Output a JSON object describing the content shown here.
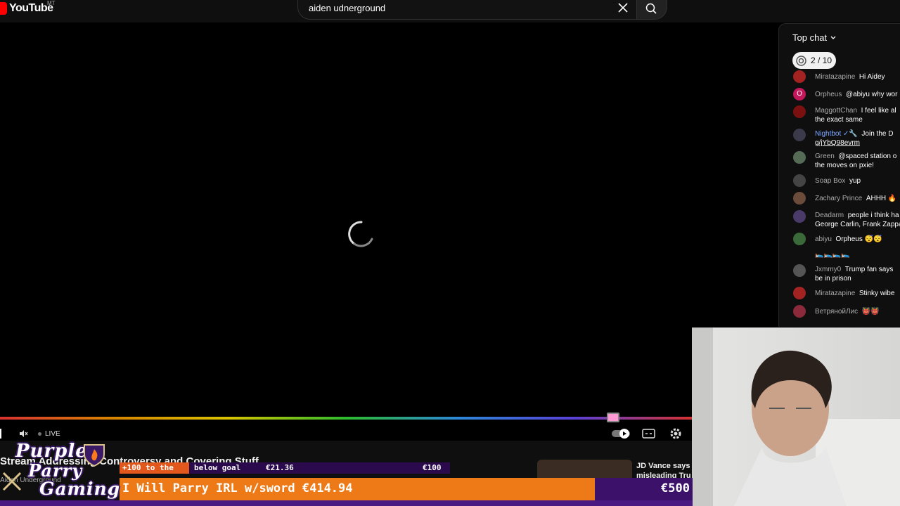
{
  "masthead": {
    "logo_text": "YouTube",
    "logo_country": "MT",
    "search_value": "aiden udnerground"
  },
  "player": {
    "live_label": "LIVE",
    "progress_colors": [
      "#ff3a3a",
      "#ff9a00",
      "#ffe600",
      "#33dd33",
      "#33a0ff",
      "#6a4cff"
    ]
  },
  "chat": {
    "mode_label": "Top chat",
    "goal_pill": "2 / 10",
    "messages": [
      {
        "author": "Miratazapine",
        "text": "Hi Aidey",
        "color": "#a32222"
      },
      {
        "author": "Orpheus",
        "text": "@abiyu why wor",
        "color": "#c2185b",
        "initial": "O"
      },
      {
        "author": "MaggottChan",
        "text": "I feel like al",
        "text2": "the exact same",
        "color": "#7a1010"
      },
      {
        "author": "Nightbot",
        "text": "Join the D",
        "text2": "g/jYbQ98evrm",
        "color": "#3a3a4a"
      },
      {
        "author": "Green",
        "text": "@spaced station o",
        "text2": "the moves on pxie!",
        "color": "#556b55"
      },
      {
        "author": "Soap Box",
        "text": "yup",
        "color": "#444444"
      },
      {
        "author": "Zachary Prince",
        "text": "AHHH",
        "color": "#6b4b3a"
      },
      {
        "author": "Deadarm",
        "text": "people i think ha",
        "text2": "George Carlin, Frank Zappa",
        "color": "#4a3a6a"
      },
      {
        "author": "abiyu",
        "text": "Orpheus",
        "text2": "🛌🛌🛌🛌",
        "color": "#3a6a3a"
      },
      {
        "author": "Jxmmy0",
        "text": "Trump fan says",
        "text2": "be in prison",
        "color": "#555555"
      },
      {
        "author": "Miratazapine",
        "text": "Stinky wibe",
        "color": "#a32222"
      },
      {
        "author": "ВетрянойЛис",
        "text": "",
        "color": "#8a2a3a"
      }
    ]
  },
  "below": {
    "stream_title": "Stream Addressing Controversy and Covering Stuff",
    "channel": "Aiden Underground",
    "suggestion_title": "JD Vance says",
    "suggestion_title2": "misleading Tru"
  },
  "overlay": {
    "brand_line1": "Purple",
    "brand_line2": "Parry",
    "brand_line3": "Gaming",
    "ticker_prefix": "+100 to the",
    "ticker_goal": "below goal",
    "ticker_amount": "€21.36",
    "ticker_target": "€100",
    "goal_label": "I Will Parry IRL w/sword €414.94",
    "goal_target": "€500",
    "goal_progress": 0.83,
    "small_progress": 0.21
  }
}
